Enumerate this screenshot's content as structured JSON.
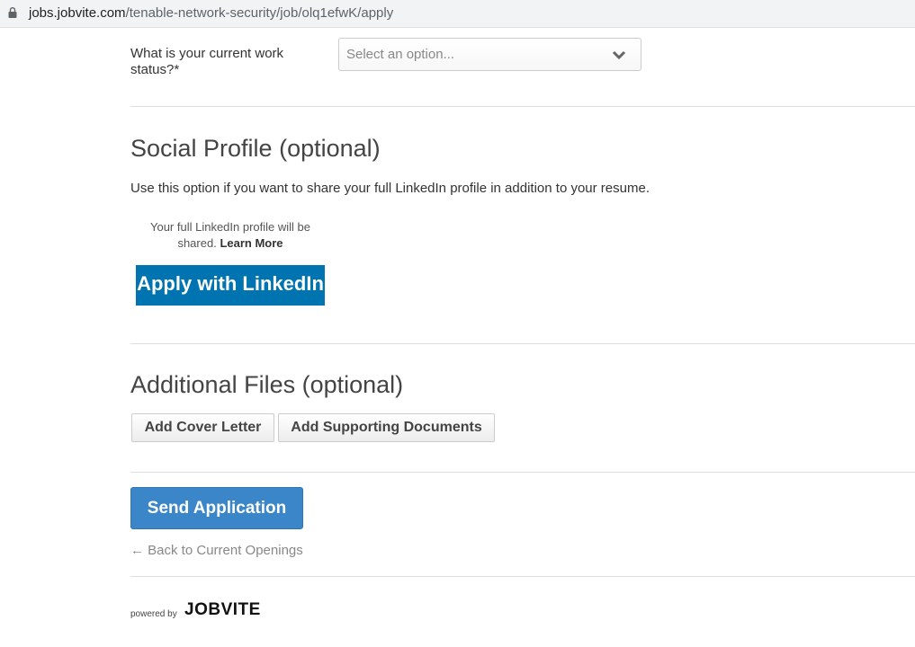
{
  "browser": {
    "url_host": "jobs.jobvite.com",
    "url_path": "/tenable-network-security/job/olq1efwK/apply"
  },
  "work_status": {
    "label": "What is your current work status?*",
    "placeholder": "Select an option..."
  },
  "social": {
    "heading": "Social Profile (optional)",
    "description": "Use this option if you want to share your full LinkedIn profile in addition to your resume.",
    "note": "Your full LinkedIn profile will be shared.",
    "learn_more": "Learn More",
    "apply_button": "Apply with LinkedIn"
  },
  "files": {
    "heading": "Additional Files (optional)",
    "cover_letter_button": "Add Cover Letter",
    "supporting_docs_button": "Add Supporting Documents"
  },
  "actions": {
    "send_button": "Send Application",
    "back_link": "← Back to Current Openings"
  },
  "footer": {
    "powered_by": "powered by",
    "brand": "JOBVITE"
  },
  "colors": {
    "linkedin_blue": "#0073b1",
    "send_blue": "#3a86c8"
  }
}
